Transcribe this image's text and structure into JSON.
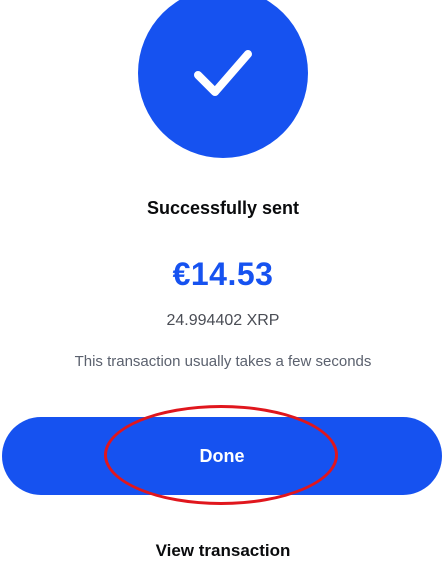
{
  "status": {
    "icon": "checkmark-icon",
    "title": "Successfully sent"
  },
  "transaction": {
    "amount_fiat": "€14.53",
    "amount_crypto": "24.994402 XRP",
    "note": "This transaction usually takes a few seconds"
  },
  "actions": {
    "done_label": "Done",
    "view_label": "View transaction"
  },
  "colors": {
    "accent": "#1652f0",
    "annotation": "#e0161d"
  }
}
